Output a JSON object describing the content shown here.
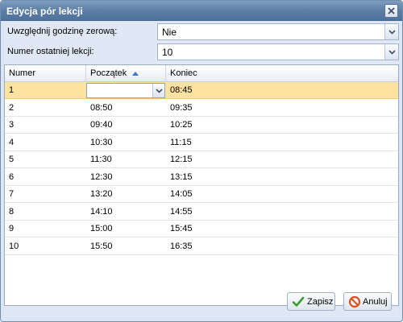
{
  "window": {
    "title": "Edycja pór lekcji"
  },
  "form": {
    "zero_hour_label": "Uwzględnij godzinę zerową:",
    "zero_hour_value": "Nie",
    "last_lesson_label": "Numer ostatniej lekcji:",
    "last_lesson_value": "10"
  },
  "grid": {
    "columns": [
      "Numer",
      "Początek",
      "Koniec"
    ],
    "sort_column": "Początek",
    "sort_direction": "ascending",
    "rows": [
      {
        "num": "1",
        "start": "",
        "end": "08:45"
      },
      {
        "num": "2",
        "start": "08:50",
        "end": "09:35"
      },
      {
        "num": "3",
        "start": "09:40",
        "end": "10:25"
      },
      {
        "num": "4",
        "start": "10:30",
        "end": "11:15"
      },
      {
        "num": "5",
        "start": "11:30",
        "end": "12:15"
      },
      {
        "num": "6",
        "start": "12:30",
        "end": "13:15"
      },
      {
        "num": "7",
        "start": "13:20",
        "end": "14:05"
      },
      {
        "num": "8",
        "start": "14:10",
        "end": "14:55"
      },
      {
        "num": "9",
        "start": "15:00",
        "end": "15:45"
      },
      {
        "num": "10",
        "start": "15:50",
        "end": "16:35"
      }
    ]
  },
  "buttons": {
    "save": "Zapisz",
    "cancel": "Anuluj"
  },
  "icons": {
    "close": "close-icon",
    "save": "checkmark-icon",
    "cancel": "prohibited-icon"
  },
  "colors": {
    "titlebar": "#5d7fa6",
    "selected_row": "#fde2a0",
    "save_check": "#3e9b2f",
    "cancel_icon": "#d9531e"
  }
}
